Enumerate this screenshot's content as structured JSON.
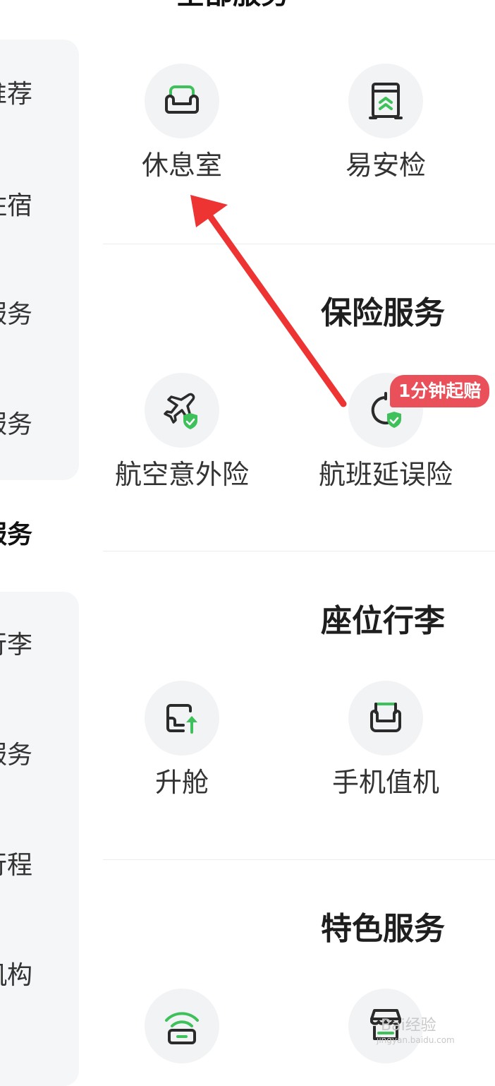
{
  "header": {
    "title": "全部服务"
  },
  "sidebar": {
    "top_items": [
      "推荐",
      "住宿",
      "服务",
      "服务"
    ],
    "section_label": "服务",
    "bottom_items": [
      "行李",
      "服务",
      "行程",
      "机构"
    ]
  },
  "sections": {
    "insurance": {
      "title": "保险服务"
    },
    "seat_baggage": {
      "title": "座位行李"
    },
    "special": {
      "title": "特色服务"
    }
  },
  "services": {
    "lounge": {
      "label": "休息室",
      "icon": "sofa-icon"
    },
    "easy_security": {
      "label": "易安检",
      "icon": "security-gate-icon"
    },
    "flight_accident": {
      "label": "航空意外险",
      "icon": "plane-shield-icon"
    },
    "flight_delay": {
      "label": "航班延误险",
      "icon": "clock-shield-icon",
      "badge": "1分钟起赔"
    },
    "upgrade": {
      "label": "升舱",
      "icon": "seat-upgrade-icon"
    },
    "mobile_checkin": {
      "label": "手机值机",
      "icon": "seat-checkin-icon"
    },
    "wifi": {
      "label": "",
      "icon": "wifi-icon"
    },
    "shop": {
      "label": "",
      "icon": "store-icon"
    }
  },
  "annotation": {
    "arrow_color": "#ee3333",
    "arrow_target": "休息室"
  },
  "watermark": {
    "text": "Bai经验",
    "url": "jingyan.baidu.com"
  },
  "colors": {
    "accent_green": "#3ec05a",
    "badge_red": "#e9505a",
    "icon_stroke": "#2b2b2b"
  }
}
